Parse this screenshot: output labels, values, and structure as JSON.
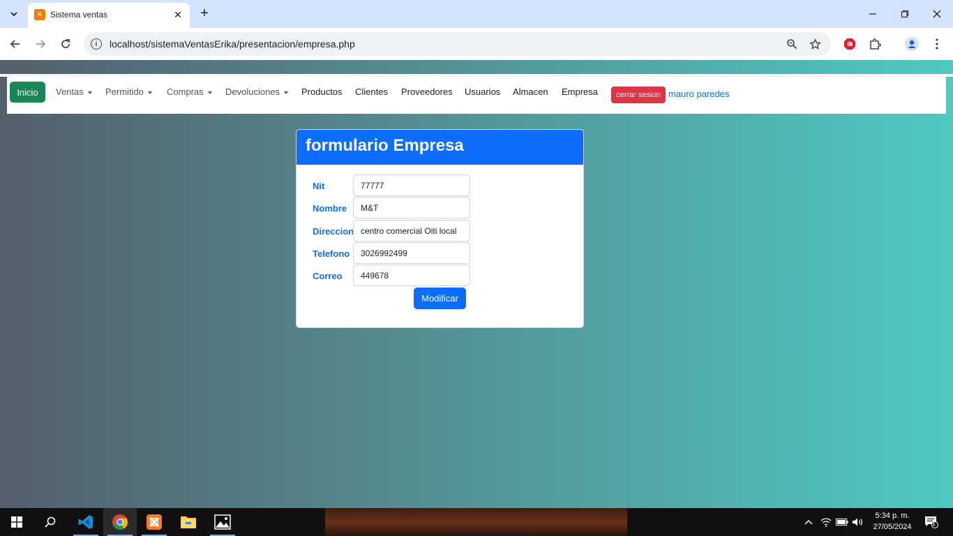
{
  "browser": {
    "tab_title": "Sistema ventas",
    "url": "localhost/sistemaVentasErika/presentacion/empresa.php"
  },
  "navbar": {
    "inicio_label": "Inicio",
    "dropdowns": [
      "Ventas",
      "Permitido",
      "Compras",
      "Devoluciones"
    ],
    "links": [
      "Productos",
      "Clientes",
      "Proveedores",
      "Usuarios",
      "Almacen",
      "Empresa"
    ],
    "logout_label": "cerrar sesion",
    "user_name": "mauro paredes"
  },
  "form": {
    "title": "formulario Empresa",
    "fields": [
      {
        "label": "Nit",
        "value": "77777"
      },
      {
        "label": "Nombre",
        "value": "M&T"
      },
      {
        "label": "Direccion",
        "value": "centro comercial Oiti local"
      },
      {
        "label": "Telefono",
        "value": "3026992499"
      },
      {
        "label": "Correo",
        "value": "449678"
      }
    ],
    "submit_label": "Modificar"
  },
  "taskbar": {
    "time": "5:34 p. m.",
    "date": "27/05/2024",
    "notification_count": "1"
  },
  "colors": {
    "primary": "#0d6efd",
    "success": "#198754",
    "danger": "#dc3545"
  }
}
